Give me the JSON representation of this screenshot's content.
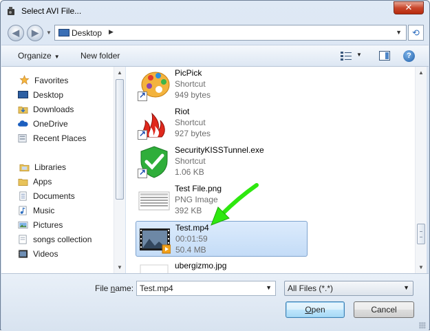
{
  "window": {
    "title": "Select AVI File..."
  },
  "titlebar": {
    "close_glyph": "✕"
  },
  "navigation": {
    "back_glyph": "◀",
    "forward_glyph": "▶",
    "address": "Desktop",
    "refresh_glyph": "⟲"
  },
  "toolbar": {
    "organize": "Organize",
    "new_folder": "New folder",
    "help_glyph": "?"
  },
  "sidebar": {
    "favorites": {
      "label": "Favorites",
      "items": [
        {
          "label": "Desktop",
          "icon": "desktop-icon"
        },
        {
          "label": "Downloads",
          "icon": "downloads-icon"
        },
        {
          "label": "OneDrive",
          "icon": "onedrive-icon"
        },
        {
          "label": "Recent Places",
          "icon": "recent-places-icon"
        }
      ]
    },
    "libraries": {
      "label": "Libraries",
      "items": [
        {
          "label": "Apps",
          "icon": "folder-icon"
        },
        {
          "label": "Documents",
          "icon": "documents-icon"
        },
        {
          "label": "Music",
          "icon": "music-icon"
        },
        {
          "label": "Pictures",
          "icon": "pictures-icon"
        },
        {
          "label": "songs collection",
          "icon": "library-icon"
        },
        {
          "label": "Videos",
          "icon": "videos-icon"
        }
      ]
    }
  },
  "files": [
    {
      "name": "PicPick",
      "type": "Shortcut",
      "size": "949 bytes",
      "icon": "picpick-icon"
    },
    {
      "name": "Riot",
      "type": "Shortcut",
      "size": "927 bytes",
      "icon": "riot-icon"
    },
    {
      "name": "SecurityKISSTunnel.exe",
      "type": "Shortcut",
      "size": "1.06 KB",
      "icon": "security-kiss-icon"
    },
    {
      "name": "Test File.png",
      "type": "PNG Image",
      "size": "392 KB",
      "icon": "png-thumbnail-icon"
    },
    {
      "name": "Test.mp4",
      "type": "00:01:59",
      "size": "50.4 MB",
      "icon": "video-thumbnail-icon",
      "selected": true
    },
    {
      "name": "ubergizmo.jpg",
      "type": "",
      "size": "",
      "icon": "jpg-thumbnail-icon"
    }
  ],
  "bottom": {
    "file_name_label_prefix": "File ",
    "file_name_label_key": "n",
    "file_name_label_suffix": "ame:",
    "file_name_value": "Test.mp4",
    "filter_value": "All Files (*.*)",
    "open_key": "O",
    "open_rest": "pen",
    "cancel": "Cancel"
  },
  "colors": {
    "selection": "#c4dcf7",
    "annotation_arrow": "#2ee80f",
    "accent": "#2d6ec0"
  }
}
